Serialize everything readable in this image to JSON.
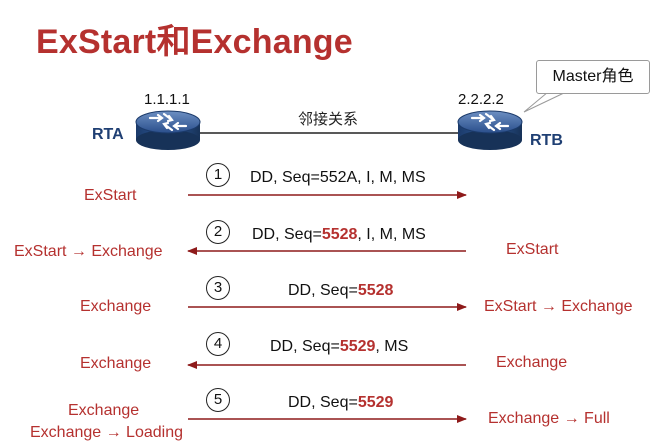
{
  "title": "ExStart和Exchange",
  "routers": {
    "left": {
      "name": "RTA",
      "ip": "1.1.1.1"
    },
    "right": {
      "name": "RTB",
      "ip": "2.2.2.2"
    }
  },
  "callout": "Master角色",
  "neighbor_label": "邻接关系",
  "colors": {
    "accent": "#b5312f",
    "router": "#1f3f73",
    "arrow": "#8e1a1a"
  },
  "icons": {
    "router": "router-icon"
  },
  "steps": [
    {
      "num": "1",
      "msg_pre": "DD, Seq=552A, I, M, MS",
      "msg_hl": "",
      "msg_post": "",
      "direction": "right",
      "left_state": "ExStart",
      "left_state2": "",
      "right_state": ""
    },
    {
      "num": "2",
      "msg_pre": "DD, Seq=",
      "msg_hl": "5528",
      "msg_post": ", I, M, MS",
      "direction": "left",
      "left_state": "ExStart → Exchange",
      "left_state2": "",
      "right_state": "ExStart"
    },
    {
      "num": "3",
      "msg_pre": "DD, Seq=",
      "msg_hl": "5528",
      "msg_post": "",
      "direction": "right",
      "left_state": "Exchange",
      "left_state2": "",
      "right_state": "ExStart → Exchange"
    },
    {
      "num": "4",
      "msg_pre": "DD, Seq=",
      "msg_hl": "5529",
      "msg_post": ", MS",
      "direction": "left",
      "left_state": "Exchange",
      "left_state2": "",
      "right_state": "Exchange"
    },
    {
      "num": "5",
      "msg_pre": "DD, Seq=",
      "msg_hl": "5529",
      "msg_post": "",
      "direction": "right",
      "left_state": "Exchange",
      "left_state2": "Exchange → Loading",
      "right_state": "Exchange → Full"
    }
  ]
}
